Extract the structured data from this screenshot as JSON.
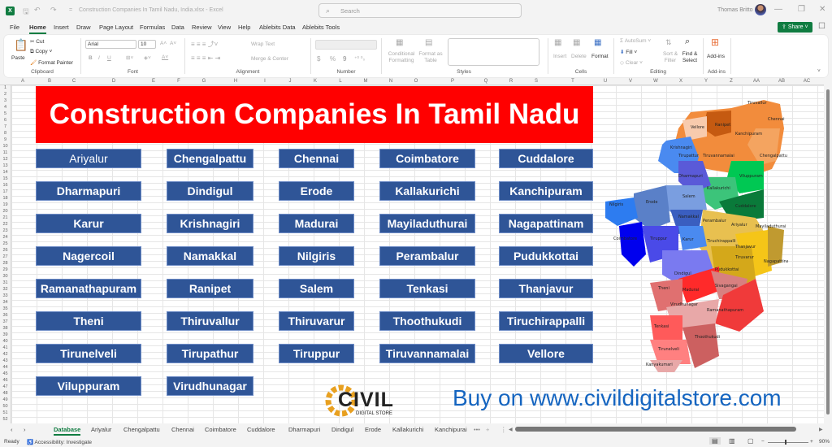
{
  "window": {
    "app_logo": "X",
    "title": "Construction Companies In Tamil Nadu, India.xlsx - Excel",
    "search_placeholder": "Search",
    "user_name": "Thomas Britto",
    "minimize": "—",
    "restore": "❐",
    "close": "✕"
  },
  "quick_access": {
    "save": "🖫",
    "undo": "↶",
    "redo": "↷",
    "customize": "="
  },
  "menu": {
    "items": [
      "File",
      "Home",
      "Insert",
      "Draw",
      "Page Layout",
      "Formulas",
      "Data",
      "Review",
      "View",
      "Help",
      "Ablebits Data",
      "Ablebits Tools"
    ],
    "active": "Home",
    "share_label": "Share"
  },
  "ribbon": {
    "clipboard": {
      "paste": "Paste",
      "cut": "Cut",
      "copy": "Copy",
      "format_painter": "Format Painter",
      "label": "Clipboard"
    },
    "font": {
      "name": "Arial",
      "size": "10",
      "bold": "B",
      "italic": "I",
      "underline": "U",
      "grow": "A˄",
      "shrink": "A˅",
      "label": "Font"
    },
    "alignment": {
      "wrap_text": "Wrap Text",
      "merge_center": "Merge & Center",
      "label": "Alignment"
    },
    "number": {
      "format": "",
      "currency": "$",
      "percent": "%",
      "comma": "9",
      "label": "Number"
    },
    "styles": {
      "conditional": "Conditional Formatting",
      "format_table": "Format as Table",
      "label": "Styles"
    },
    "cells": {
      "insert": "Insert",
      "delete": "Delete",
      "format": "Format",
      "label": "Cells"
    },
    "editing": {
      "autosum": "AutoSum",
      "fill": "Fill",
      "clear": "Clear",
      "sort_filter": "Sort & Filter",
      "find_select": "Find & Select",
      "label": "Editing"
    },
    "addins": {
      "addins": "Add-ins",
      "label": "Add-ins"
    }
  },
  "columns": [
    "A",
    "B",
    "C",
    "D",
    "E",
    "F",
    "G",
    "H",
    "I",
    "J",
    "K",
    "L",
    "M",
    "N",
    "O",
    "P",
    "Q",
    "R",
    "S",
    "T",
    "U",
    "V",
    "W",
    "X",
    "Y",
    "Z",
    "AA",
    "AB",
    "AC"
  ],
  "sheet": {
    "banner_title": "Construction Companies In Tamil Nadu",
    "districts": [
      [
        "Ariyalur",
        "Chengalpattu",
        "Chennai",
        "Coimbatore",
        "Cuddalore"
      ],
      [
        "Dharmapuri",
        "Dindigul",
        "Erode",
        "Kallakurichi",
        "Kanchipuram"
      ],
      [
        "Karur",
        "Krishnagiri",
        "Madurai",
        "Mayiladuthurai",
        "Nagapattinam"
      ],
      [
        "Nagercoil",
        "Namakkal",
        "Nilgiris",
        "Perambalur",
        "Pudukkottai"
      ],
      [
        "Ramanathapuram",
        "Ranipet",
        "Salem",
        "Tenkasi",
        "Thanjavur"
      ],
      [
        "Theni",
        "Thiruvallur",
        "Thiruvarur",
        "Thoothukudi",
        "Tiruchirappalli"
      ],
      [
        "Tirunelveli",
        "Tirupathur",
        "Tiruppur",
        "Tiruvannamalai",
        "Vellore"
      ],
      [
        "Viluppuram",
        "Virudhunagar"
      ]
    ],
    "map_labels": [
      "Tiruvallur",
      "Chennai",
      "Ranipet",
      "Vellore",
      "Kanchipuram",
      "Krishnagiri",
      "Tirupattur",
      "Tiruvannamalai",
      "Chengalpattu",
      "Dharmapuri",
      "Viluppuram",
      "Kallakurichi",
      "Salem",
      "Nilgiris",
      "Erode",
      "Cuddalore",
      "Namakkal",
      "Perambalur",
      "Ariyalur",
      "Mayiladuthurai",
      "Coimbatore",
      "Tiruppur",
      "Karur",
      "Tiruchirappalli",
      "Thanjavur",
      "Tiruvarur",
      "Nagapattinam",
      "Dindigul",
      "Pudukkottai",
      "Theni",
      "Madurai",
      "Sivagangai",
      "Virudhunagar",
      "Ramanathapuram",
      "Tenkasi",
      "Thoothukudi",
      "Tirunelveli",
      "Kanyakumari"
    ],
    "logo_main": "CIVIL",
    "logo_sub": "DIGITAL STORE",
    "promo_text": "Buy on www.civildigitalstore.com"
  },
  "sheet_tabs": {
    "items": [
      "Database",
      "Ariyalur",
      "Chengalpattu",
      "Chennai",
      "Coimbatore",
      "Cuddalore",
      "Dharmapuri",
      "Dindigul",
      "Erode",
      "Kallakurichi",
      "Kanchipurai"
    ],
    "active": "Database",
    "more": "•••",
    "add": "+"
  },
  "status": {
    "ready": "Ready",
    "accessibility": "Accessibility: Investigate",
    "zoom": "90%"
  },
  "colors": {
    "banner": "#ff0000",
    "button": "#2f5597",
    "accent": "#107c41",
    "promo": "#1565c0"
  }
}
